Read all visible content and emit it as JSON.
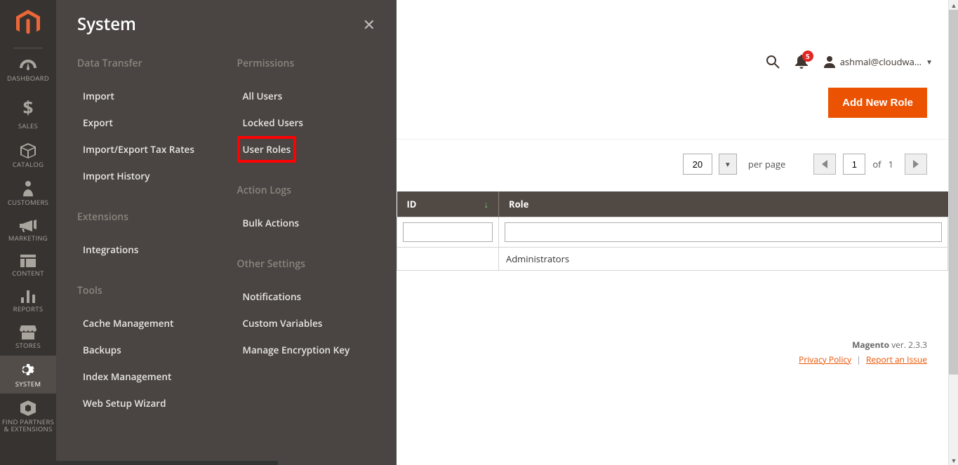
{
  "leftnav": {
    "items": [
      {
        "id": "dashboard",
        "label": "DASHBOARD"
      },
      {
        "id": "sales",
        "label": "SALES"
      },
      {
        "id": "catalog",
        "label": "CATALOG"
      },
      {
        "id": "customers",
        "label": "CUSTOMERS"
      },
      {
        "id": "marketing",
        "label": "MARKETING"
      },
      {
        "id": "content",
        "label": "CONTENT"
      },
      {
        "id": "reports",
        "label": "REPORTS"
      },
      {
        "id": "stores",
        "label": "STORES"
      },
      {
        "id": "system",
        "label": "SYSTEM"
      },
      {
        "id": "find-partners",
        "label": "FIND PARTNERS\n& EXTENSIONS"
      }
    ]
  },
  "submenu": {
    "title": "System",
    "col1": {
      "sec1_title": "Data Transfer",
      "sec1_links": [
        "Import",
        "Export",
        "Import/Export Tax Rates",
        "Import History"
      ],
      "sec2_title": "Extensions",
      "sec2_links": [
        "Integrations"
      ],
      "sec3_title": "Tools",
      "sec3_links": [
        "Cache Management",
        "Backups",
        "Index Management",
        "Web Setup Wizard"
      ]
    },
    "col2": {
      "sec1_title": "Permissions",
      "sec1_links": [
        "All Users",
        "Locked Users",
        "User Roles"
      ],
      "sec2_title": "Action Logs",
      "sec2_links": [
        "Bulk Actions"
      ],
      "sec3_title": "Other Settings",
      "sec3_links": [
        "Notifications",
        "Custom Variables",
        "Manage Encryption Key"
      ]
    },
    "highlighted_link": "User Roles"
  },
  "topbar": {
    "notification_count": "5",
    "username": "ashmal@cloudwa..."
  },
  "actions": {
    "add_new_role": "Add New Role"
  },
  "grid": {
    "page_size": "20",
    "per_page_label": "per page",
    "current_page": "1",
    "of_label": "of",
    "total_pages": "1",
    "columns": [
      "ID",
      "Role"
    ],
    "rows": [
      {
        "id": "",
        "role": "Administrators"
      }
    ]
  },
  "footer": {
    "product": "Magento",
    "version_label": "ver.",
    "version": "2.3.3",
    "privacy": "Privacy Policy",
    "report": "Report an Issue"
  }
}
